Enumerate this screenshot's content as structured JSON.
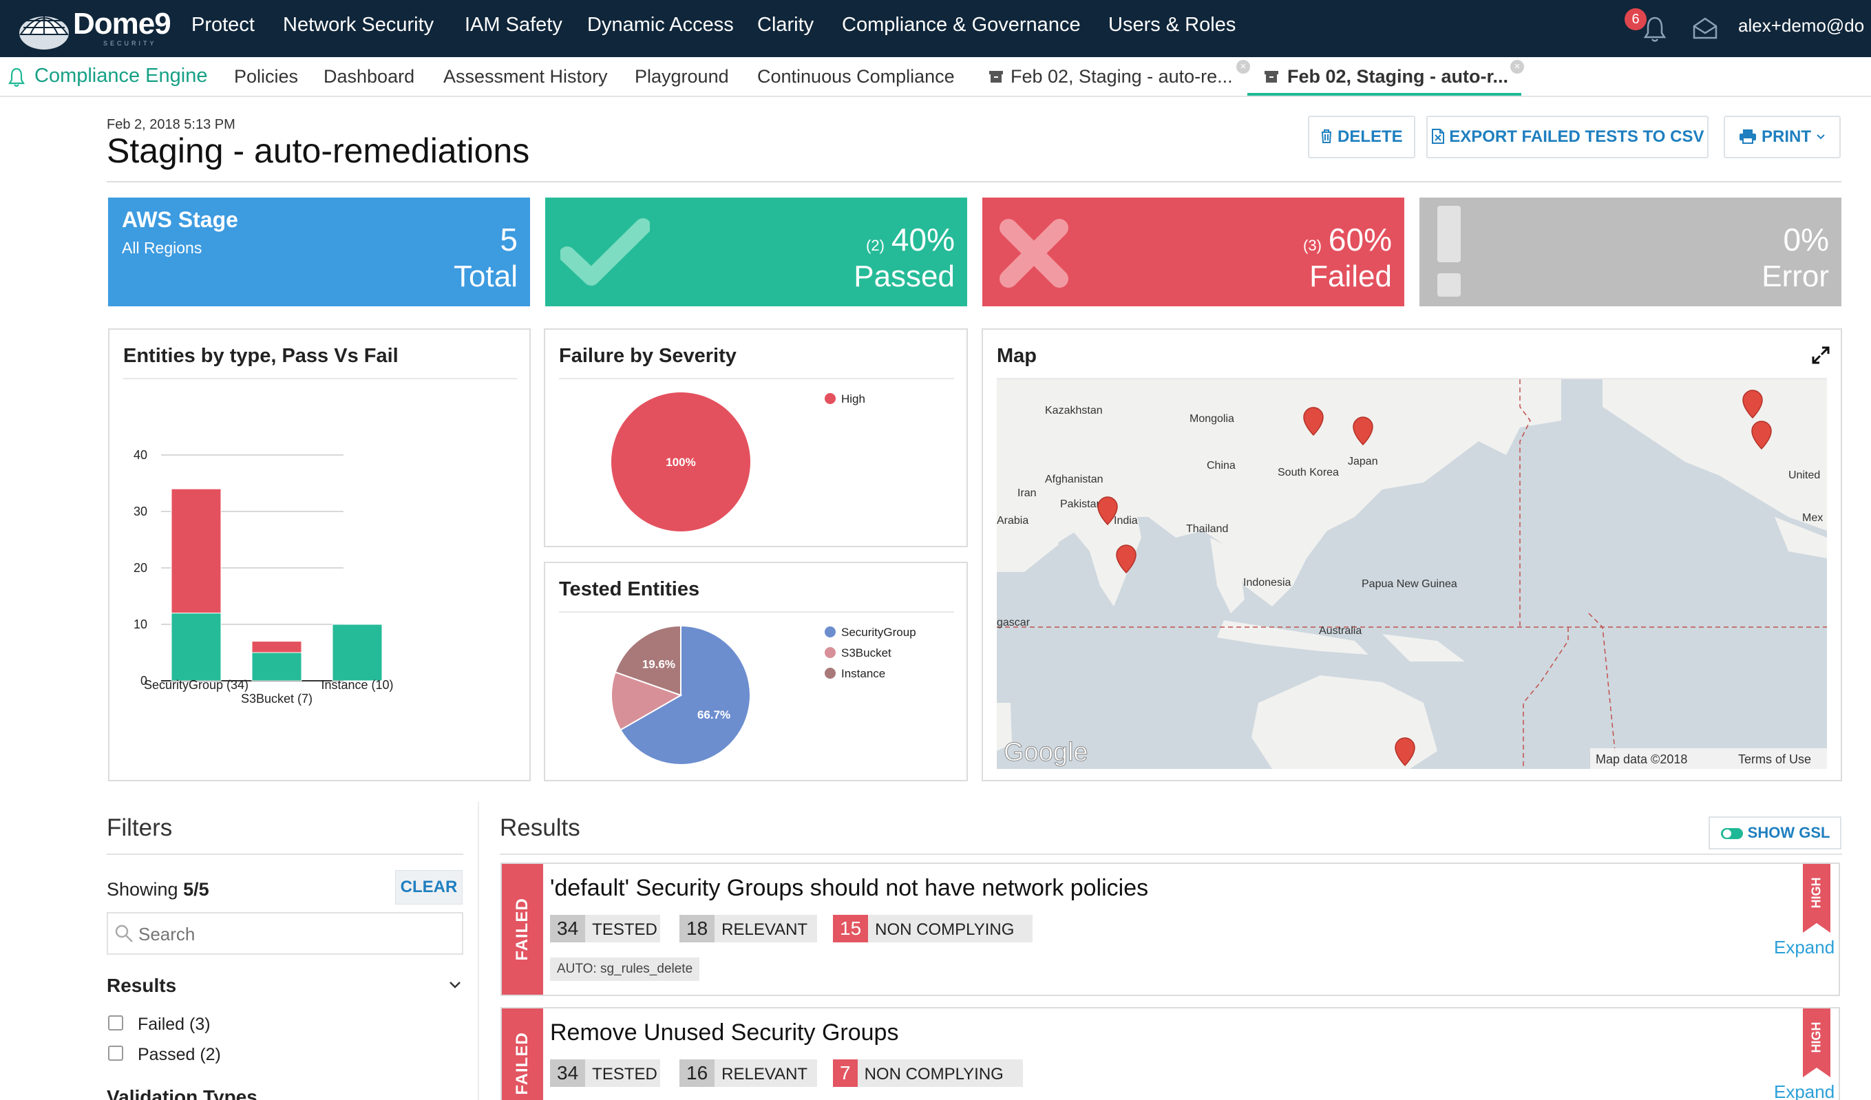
{
  "topnav": {
    "logo": "Dome9",
    "logo_sub": "SECURITY",
    "items": [
      "Protect",
      "Network Security",
      "IAM Safety",
      "Dynamic Access",
      "Clarity",
      "Compliance & Governance",
      "Users & Roles"
    ],
    "notifications_count": "6",
    "user": "alex+demo@do"
  },
  "subnav": {
    "section": "Compliance Engine",
    "items": [
      "Policies",
      "Dashboard",
      "Assessment History",
      "Playground",
      "Continuous Compliance"
    ],
    "tabs": [
      {
        "label": "Feb 02, Staging - auto-re...",
        "active": false
      },
      {
        "label": "Feb 02, Staging - auto-r...",
        "active": true
      }
    ]
  },
  "header": {
    "date": "Feb 2, 2018 5:13 PM",
    "title": "Staging - auto-remediations",
    "buttons": {
      "delete": "DELETE",
      "export": "EXPORT FAILED TESTS TO CSV",
      "print": "PRINT"
    }
  },
  "stats": {
    "total": {
      "title": "AWS Stage",
      "subtitle": "All Regions",
      "value": "5",
      "label": "Total",
      "color": "#3d9be0"
    },
    "passed": {
      "count": "(2)",
      "value": "40%",
      "label": "Passed",
      "color": "#26bb98"
    },
    "failed": {
      "count": "(3)",
      "value": "60%",
      "label": "Failed",
      "color": "#e4515e"
    },
    "error": {
      "value": "0%",
      "label": "Error",
      "color": "#bdbdbd"
    }
  },
  "panels": {
    "entities_title": "Entities by type, Pass Vs Fail",
    "severity_title": "Failure by Severity",
    "tested_title": "Tested Entities",
    "map_title": "Map"
  },
  "chart_data": [
    {
      "type": "bar",
      "title": "Entities by type, Pass Vs Fail",
      "categories": [
        "SecurityGroup (34)",
        "S3Bucket (7)",
        "Instance (10)"
      ],
      "series": [
        {
          "values": [
            12,
            5,
            10
          ],
          "color": "#26bb98"
        },
        {
          "values": [
            22,
            2,
            0
          ],
          "color": "#e4515e"
        }
      ],
      "ylim": [
        0,
        40
      ],
      "yticks": [
        0,
        10,
        20,
        30,
        40
      ],
      "stacked": true
    },
    {
      "type": "pie",
      "title": "Failure by Severity",
      "slices": [
        {
          "label": "High",
          "value": 100,
          "text": "100%",
          "color": "#e4515e"
        }
      ]
    },
    {
      "type": "pie",
      "title": "Tested Entities",
      "slices": [
        {
          "label": "SecurityGroup",
          "value": 66.7,
          "text": "66.7%",
          "color": "#6c8ecf"
        },
        {
          "label": "S3Bucket",
          "value": 13.7,
          "text": "",
          "color": "#d89098"
        },
        {
          "label": "Instance",
          "value": 19.6,
          "text": "19.6%",
          "color": "#a9797a"
        }
      ]
    }
  ],
  "map": {
    "labels": [
      "Kazakhstan",
      "Mongolia",
      "China",
      "South Korea",
      "Japan",
      "Afghanistan",
      "Iran",
      "Pakistan",
      "India",
      "Thailand",
      "Indonesia",
      "Papua New Guinea",
      "Australia",
      "Arabia",
      "gascar",
      "United",
      "Mex"
    ],
    "attribution": "Map data ©2018",
    "terms": "Terms of Use",
    "google": "Google"
  },
  "filters": {
    "title": "Filters",
    "showing_label": "Showing",
    "showing_value": "5/5",
    "clear": "CLEAR",
    "search_placeholder": "Search",
    "results_section": "Results",
    "options": [
      "Failed (3)",
      "Passed (2)"
    ],
    "next_section": "Validation Types"
  },
  "results": {
    "title": "Results",
    "show_gsl": "SHOW GSL",
    "items": [
      {
        "status": "FAILED",
        "severity": "HIGH",
        "title": "'default' Security Groups should not have network policies",
        "tested": "34",
        "relevant": "18",
        "non_complying": "15",
        "auto": "AUTO: sg_rules_delete",
        "expand": "Expand"
      },
      {
        "status": "FAILED",
        "severity": "HIGH",
        "title": "Remove Unused Security Groups",
        "tested": "34",
        "relevant": "16",
        "non_complying": "7",
        "expand": "Expand"
      }
    ],
    "labels": {
      "tested": "TESTED",
      "relevant": "RELEVANT",
      "non_complying": "NON COMPLYING"
    }
  }
}
